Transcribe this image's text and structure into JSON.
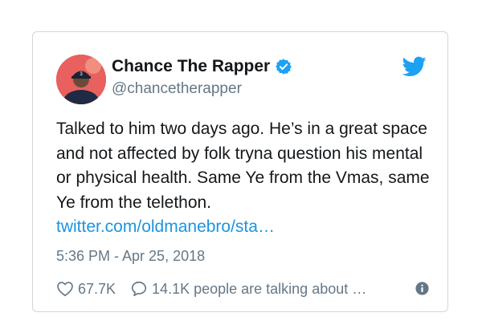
{
  "tweet": {
    "author": {
      "display_name": "Chance The Rapper",
      "handle": "@chancetherapper",
      "verified": true
    },
    "text": "Talked to him two days ago. He’s in a great space and not affected by folk tryna question his mental or physical health. Same Ye from the Vmas, same Ye from the telethon. ",
    "link_text": "twitter.com/oldmanebro/sta…",
    "timestamp": "5:36 PM - Apr 25, 2018",
    "likes": "67.7K",
    "replies_text": "14.1K people are talking about …"
  },
  "colors": {
    "link": "#1b95e0",
    "verified": "#1da1f2",
    "twitter_brand": "#1da1f2",
    "muted": "#657786",
    "avatar_bg": "#e8615f"
  },
  "icons": {
    "brand": "twitter-bird-icon",
    "verified": "verified-badge-icon",
    "like": "heart-icon",
    "reply": "speech-bubble-icon",
    "info": "info-icon"
  }
}
